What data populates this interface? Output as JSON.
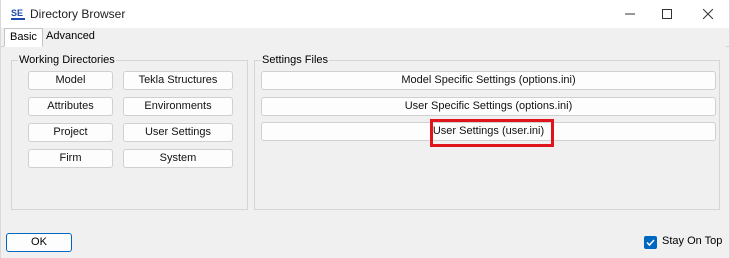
{
  "window": {
    "title": "Directory Browser",
    "app_icon": "app-logo-icon",
    "controls": [
      "minimize-icon",
      "maximize-icon",
      "close-icon"
    ]
  },
  "tabs": [
    {
      "label": "Basic",
      "active": true
    },
    {
      "label": "Advanced",
      "active": false
    }
  ],
  "working_directories": {
    "label": "Working Directories",
    "buttons": [
      "Model",
      "Tekla Structures",
      "Attributes",
      "Environments",
      "Project",
      "User Settings",
      "Firm",
      "System"
    ]
  },
  "settings_files": {
    "label": "Settings Files",
    "buttons": [
      "Model Specific Settings (options.ini)",
      "User Specific Settings (options.ini)",
      "User Settings (user.ini)"
    ],
    "highlighted": "User Settings (user.ini)",
    "highlight_color": "#e0141c"
  },
  "footer": {
    "ok_label": "OK",
    "stay_on_top_label": "Stay On Top",
    "stay_on_top_checked": true
  },
  "colors": {
    "accent": "#0067c0",
    "highlight": "#e0141c"
  }
}
